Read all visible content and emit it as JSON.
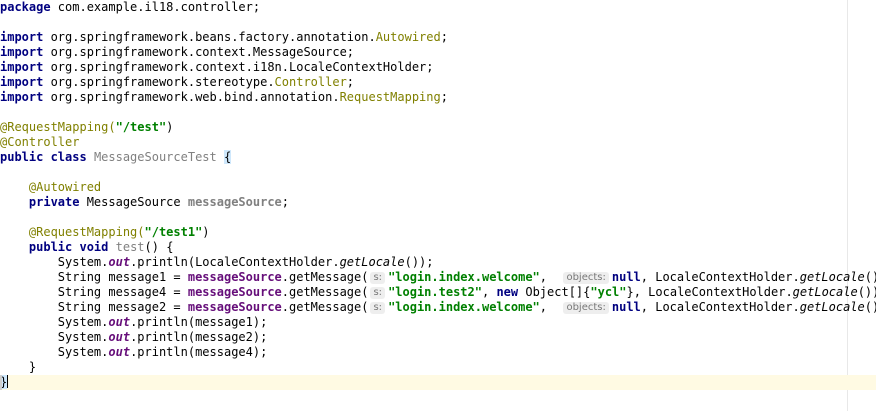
{
  "editor": {
    "lines": [
      [
        {
          "t": "package",
          "c": "kw"
        },
        {
          "t": " com.example.il18.controller;"
        }
      ],
      [],
      [
        {
          "t": "import",
          "c": "kw"
        },
        {
          "t": " org.springframework.beans.factory.annotation."
        },
        {
          "t": "Autowired",
          "c": "ann"
        },
        {
          "t": ";"
        }
      ],
      [
        {
          "t": "import",
          "c": "kw"
        },
        {
          "t": " org.springframework.context.MessageSource;"
        }
      ],
      [
        {
          "t": "import",
          "c": "kw"
        },
        {
          "t": " org.springframework.context.i18n.LocaleContextHolder;"
        }
      ],
      [
        {
          "t": "import",
          "c": "kw"
        },
        {
          "t": " org.springframework.stereotype."
        },
        {
          "t": "Controller",
          "c": "ann"
        },
        {
          "t": ";"
        }
      ],
      [
        {
          "t": "import",
          "c": "kw"
        },
        {
          "t": " org.springframework.web.bind.annotation."
        },
        {
          "t": "RequestMapping",
          "c": "ann"
        },
        {
          "t": ";"
        }
      ],
      [],
      [
        {
          "t": "@RequestMapping(",
          "c": "ann"
        },
        {
          "t": "\"/test\"",
          "c": "str"
        },
        {
          "t": ")"
        }
      ],
      [
        {
          "t": "@Controller",
          "c": "ann"
        }
      ],
      [
        {
          "t": "public class",
          "c": "kw"
        },
        {
          "t": " "
        },
        {
          "t": "MessageSourceTest",
          "c": "cls-unused"
        },
        {
          "t": " "
        },
        {
          "t": "{",
          "c": "brace-hl"
        }
      ],
      [],
      [
        {
          "t": "    "
        },
        {
          "t": "@Autowired",
          "c": "ann"
        }
      ],
      [
        {
          "t": "    "
        },
        {
          "t": "private",
          "c": "kw"
        },
        {
          "t": " MessageSource "
        },
        {
          "t": "messageSource",
          "c": "fld-unused"
        },
        {
          "t": ";"
        }
      ],
      [],
      [
        {
          "t": "    "
        },
        {
          "t": "@RequestMapping(",
          "c": "ann"
        },
        {
          "t": "\"/test1\"",
          "c": "str"
        },
        {
          "t": ")"
        }
      ],
      [
        {
          "t": "    "
        },
        {
          "t": "public void",
          "c": "kw"
        },
        {
          "t": " "
        },
        {
          "t": "test",
          "c": "cls-unused"
        },
        {
          "t": "() {"
        }
      ],
      [
        {
          "t": "        System."
        },
        {
          "t": "out",
          "c": "static"
        },
        {
          "t": ".println(LocaleContextHolder."
        },
        {
          "t": "getLocale",
          "c": "italic"
        },
        {
          "t": "());"
        }
      ],
      [
        {
          "t": "        String message1 = "
        },
        {
          "t": "messageSource",
          "c": "fld"
        },
        {
          "t": ".getMessage("
        },
        {
          "h": "s:"
        },
        {
          "t": "\"login.index.welcome\"",
          "c": "str"
        },
        {
          "t": ",  "
        },
        {
          "h": "objects:"
        },
        {
          "t": "null",
          "c": "kw"
        },
        {
          "t": ", LocaleContextHolder."
        },
        {
          "t": "getLocale",
          "c": "italic"
        },
        {
          "t": "());"
        }
      ],
      [
        {
          "t": "        String message4 = "
        },
        {
          "t": "messageSource",
          "c": "fld"
        },
        {
          "t": ".getMessage("
        },
        {
          "h": "s:"
        },
        {
          "t": "\"login.test2\"",
          "c": "str"
        },
        {
          "t": ", "
        },
        {
          "t": "new",
          "c": "kw"
        },
        {
          "t": " Object[]{"
        },
        {
          "t": "\"ycl\"",
          "c": "str"
        },
        {
          "t": "}, LocaleContextHolder."
        },
        {
          "t": "getLocale",
          "c": "italic"
        },
        {
          "t": "());"
        }
      ],
      [
        {
          "t": "        String message2 = "
        },
        {
          "t": "messageSource",
          "c": "fld"
        },
        {
          "t": ".getMessage("
        },
        {
          "h": "s:"
        },
        {
          "t": "\"login.index.welcome\"",
          "c": "str"
        },
        {
          "t": ",  "
        },
        {
          "h": "objects:"
        },
        {
          "t": "null",
          "c": "kw"
        },
        {
          "t": ", LocaleContextHolder."
        },
        {
          "t": "getLocale",
          "c": "italic"
        },
        {
          "t": "());"
        }
      ],
      [
        {
          "t": "        System."
        },
        {
          "t": "out",
          "c": "static"
        },
        {
          "t": ".println(message1);"
        }
      ],
      [
        {
          "t": "        System."
        },
        {
          "t": "out",
          "c": "static"
        },
        {
          "t": ".println(message2);"
        }
      ],
      [
        {
          "t": "        System."
        },
        {
          "t": "out",
          "c": "static"
        },
        {
          "t": ".println(message4);"
        }
      ],
      [
        {
          "t": "    }"
        }
      ],
      [
        {
          "t": "}",
          "c": "brace-hl"
        },
        {
          "caret": true
        }
      ]
    ],
    "current_line": 25,
    "colors": {
      "keyword": "#000080",
      "string": "#008000",
      "annotation": "#808000",
      "field": "#660e7a",
      "unused": "#808080",
      "current_line_bg": "#fffae3",
      "brace_match_bg": "#cfe8fc"
    }
  }
}
